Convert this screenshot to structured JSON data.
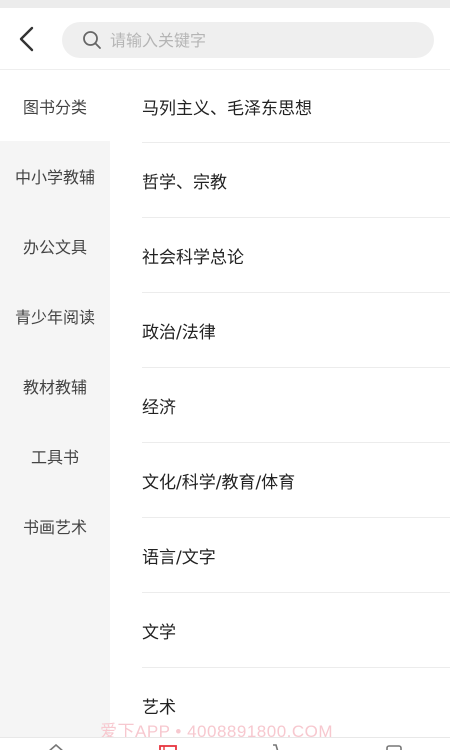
{
  "search": {
    "placeholder": "请输入关键字",
    "value": ""
  },
  "sidebar": {
    "items": [
      {
        "label": "图书分类",
        "active": true
      },
      {
        "label": "中小学教辅",
        "active": false
      },
      {
        "label": "办公文具",
        "active": false
      },
      {
        "label": "青少年阅读",
        "active": false
      },
      {
        "label": "教材教辅",
        "active": false
      },
      {
        "label": "工具书",
        "active": false
      },
      {
        "label": "书画艺术",
        "active": false
      }
    ]
  },
  "categories": [
    "马列主义、毛泽东思想",
    "哲学、宗教",
    "社会科学总论",
    "政治/法律",
    "经济",
    "文化/科学/教育/体育",
    "语言/文字",
    "文学",
    "艺术"
  ],
  "watermark": "爱下APP • 4008891800.COM",
  "colors": {
    "accent": "#e8353f",
    "sidebar_bg": "#f5f5f5",
    "search_bg": "#efefef"
  },
  "icons": [
    "back-arrow-icon",
    "search-icon",
    "home-icon",
    "category-icon",
    "cart-icon",
    "profile-icon"
  ]
}
